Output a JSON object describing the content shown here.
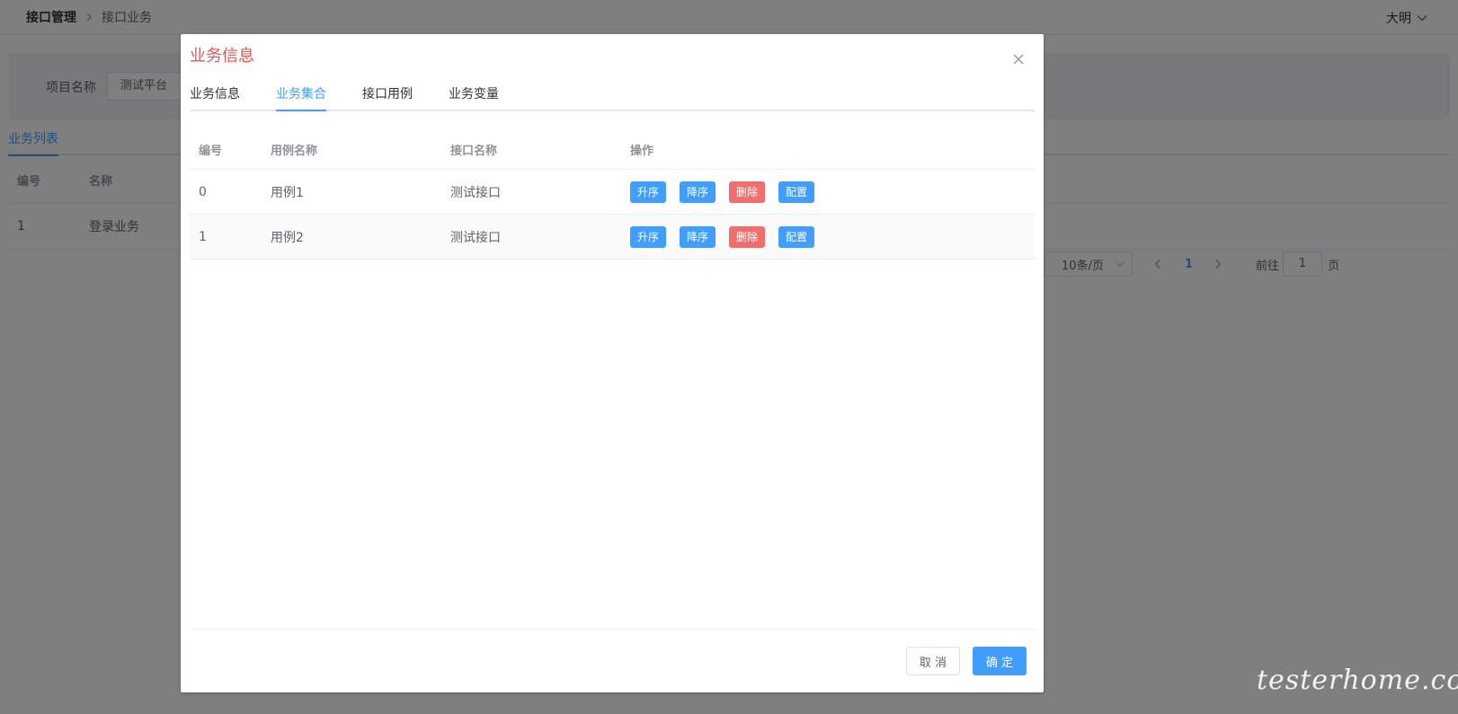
{
  "header": {
    "breadcrumb": [
      "接口管理",
      "接口业务"
    ],
    "user_name": "大明"
  },
  "filter": {
    "label": "项目名称",
    "value": "测试平台"
  },
  "background_list": {
    "tab": "业务列表",
    "columns": [
      "编号",
      "名称"
    ],
    "rows": [
      {
        "id": "1",
        "name": "登录业务"
      }
    ]
  },
  "pagination": {
    "page_size": "10条/页",
    "current_page": "1",
    "goto_label": "前往",
    "goto_value": "1",
    "goto_unit": "页"
  },
  "dialog": {
    "title": "业务信息",
    "tabs": [
      {
        "label": "业务信息",
        "active": false
      },
      {
        "label": "业务集合",
        "active": true
      },
      {
        "label": "接口用例",
        "active": false
      },
      {
        "label": "业务变量",
        "active": false
      }
    ],
    "columns": [
      "编号",
      "用例名称",
      "接口名称",
      "操作"
    ],
    "rows": [
      {
        "id": "0",
        "case": "用例1",
        "api": "测试接口"
      },
      {
        "id": "1",
        "case": "用例2",
        "api": "测试接口"
      }
    ],
    "actions": {
      "up": "升序",
      "down": "降序",
      "delete": "删除",
      "config": "配置"
    },
    "cancel_label": "取 消",
    "ok_label": "确 定"
  },
  "watermark": "testerhome.com",
  "colors": {
    "primary": "#409eff",
    "danger": "#f56c6c",
    "title": "#e45656"
  }
}
